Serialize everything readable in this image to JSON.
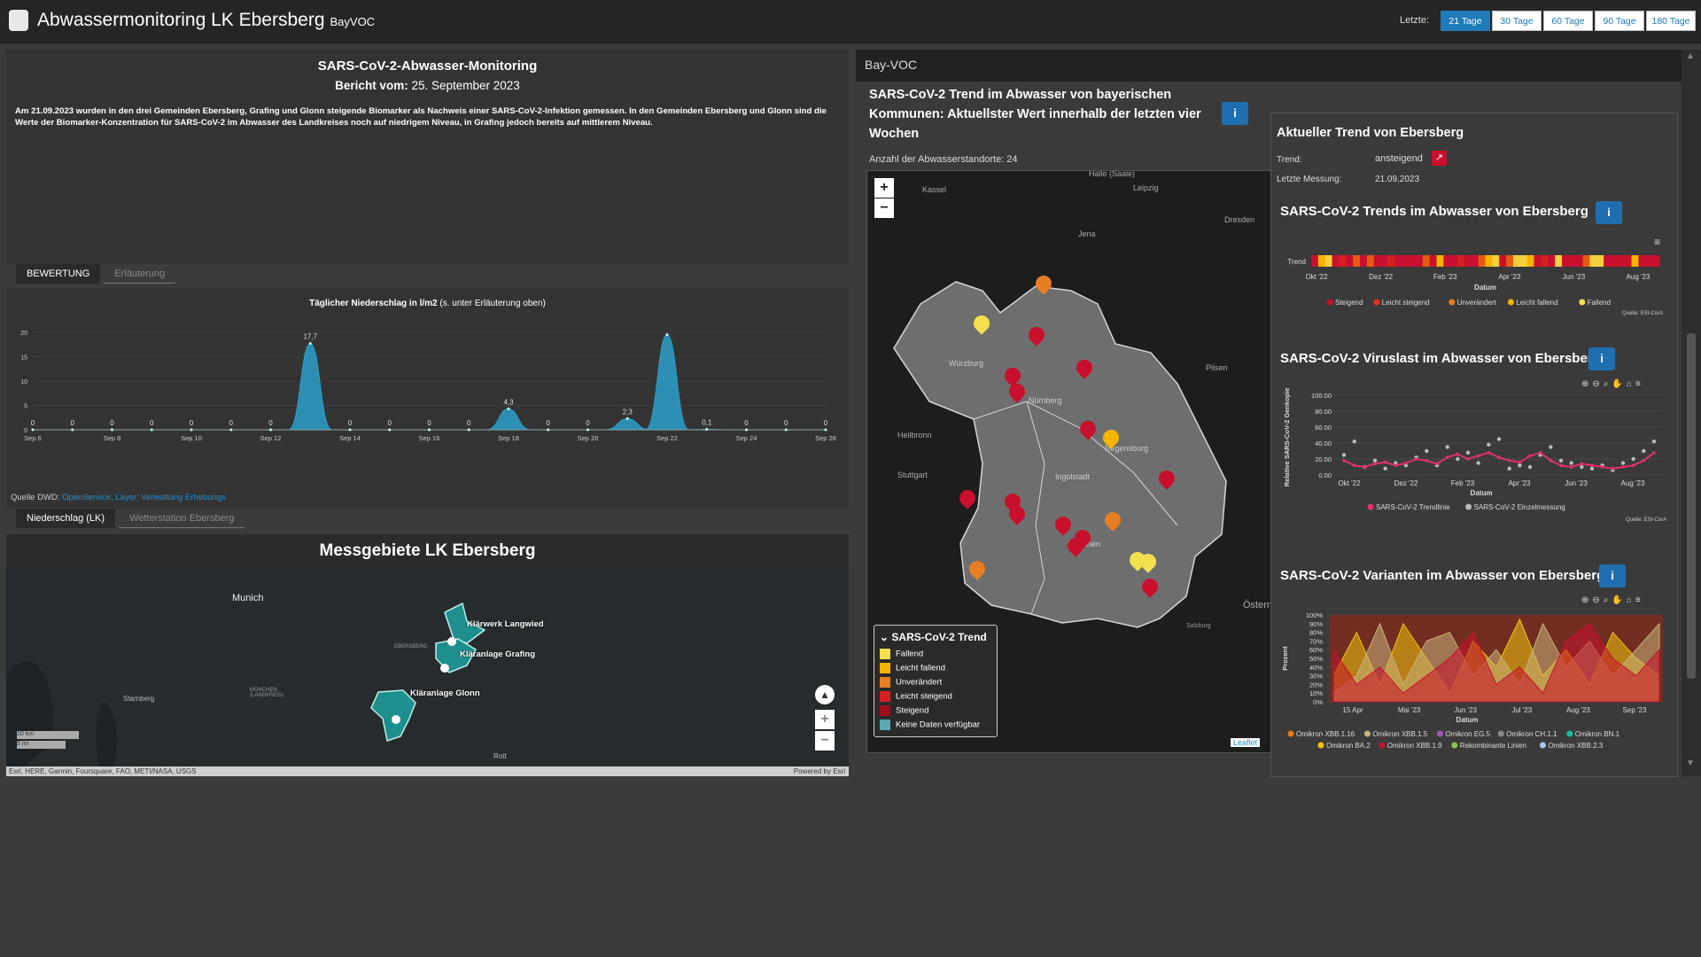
{
  "header": {
    "title": "Abwassermonitoring LK Ebersberg",
    "subtitle": "BayVOC",
    "range_label": "Letzte:",
    "ranges": [
      "21 Tage",
      "30 Tage",
      "60 Tage",
      "90 Tage",
      "180 Tage"
    ],
    "active_range": "21 Tage"
  },
  "report": {
    "title": "SARS-CoV-2-Abwasser-Monitoring",
    "date_label": "Bericht vom:",
    "date_value": "25. September 2023",
    "text": "Am 21.09.2023 wurden in den drei Gemeinden Ebersberg, Grafing und Glonn steigende Biomarker als Nachweis einer SARS-CoV-2-Infektion gemessen. In den Gemeinden Ebersberg und Glonn sind die Werte der Biomarker-Konzentration für SARS-CoV-2 im Abwasser des Landkreises noch auf niedrigem Niveau, in Grafing jedoch bereits auf mittlerem Niveau."
  },
  "tabs_top": [
    "BEWERTUNG",
    "Erläuterung"
  ],
  "tabs_bottom": [
    "Niederschlag (LK)",
    "Wetterstation Ebersberg"
  ],
  "chart_title": "Täglicher Niederschlag in l/m2",
  "chart_title_note": "(s. unter Erläuterung oben)",
  "dwd": {
    "label": "Quelle DWD:",
    "link": "OpenService, Layer: Verwaltung Erhebungs"
  },
  "chart_data": [
    {
      "type": "area",
      "title": "Täglicher Niederschlag in l/m2",
      "x": [
        "Sep 6",
        "Sep 7",
        "Sep 8",
        "Sep 9",
        "Sep 10",
        "Sep 11",
        "Sep 12",
        "Sep 13",
        "Sep 14",
        "Sep 15",
        "Sep 16",
        "Sep 17",
        "Sep 18",
        "Sep 19",
        "Sep 20",
        "Sep 21",
        "Sep 22",
        "Sep 23",
        "Sep 24",
        "Sep 25",
        "Sep 26"
      ],
      "values": [
        0,
        0,
        0,
        0,
        0,
        0,
        0,
        17.7,
        0,
        0,
        0,
        0,
        4.3,
        0,
        0,
        2.3,
        19.5,
        0.1,
        0,
        0,
        0
      ],
      "data_labels": [
        "0",
        "0",
        "0",
        "0",
        "0",
        "0",
        "0",
        "17,7",
        "0",
        "0",
        "0",
        "0",
        "4,3",
        "0",
        "0",
        "2,3",
        "",
        "0,1",
        "0",
        "0",
        "0"
      ],
      "x_ticks": [
        "Sep 6",
        "Sep 8",
        "Sep 10",
        "Sep 12",
        "Sep 14",
        "Sep 16",
        "Sep 18",
        "Sep 20",
        "Sep 22",
        "Sep 24",
        "Sep 26"
      ],
      "y_ticks": [
        "0",
        "5",
        "10",
        "15",
        "20"
      ],
      "ylim": [
        0,
        20
      ],
      "color": "#2a9fc9"
    },
    {
      "type": "heatmap",
      "title": "SARS-CoV-2 Trends im Abwasser von Ebersberg",
      "ylabel": "Trend",
      "xlabel": "Datum",
      "x_ticks": [
        "Okt '22",
        "Dez '22",
        "Feb '23",
        "Apr '23",
        "Jun '23",
        "Aug '23"
      ],
      "cells": [
        "#c8102e",
        "#f4b400",
        "#f4d03f",
        "#c8102e",
        "#d62020",
        "#c8102e",
        "#e35b12",
        "#c8102e",
        "#e35b12",
        "#c8102e",
        "#c8102e",
        "#d62020",
        "#c8102e",
        "#c8102e",
        "#c8102e",
        "#c8102e",
        "#e35b12",
        "#c8102e",
        "#f4b400",
        "#c8102e",
        "#c8102e",
        "#d62020",
        "#c8102e",
        "#c8102e",
        "#e35b12",
        "#f4b400",
        "#f4d03f",
        "#c8102e",
        "#e35b12",
        "#f4d03f",
        "#f4d03f",
        "#f4b400",
        "#c8102e",
        "#d62020",
        "#c8102e",
        "#f4d03f",
        "#c8102e",
        "#c8102e",
        "#c8102e",
        "#e35b12",
        "#f4d03f",
        "#f4d03f",
        "#c8102e",
        "#c8102e",
        "#c8102e",
        "#c8102e",
        "#f4b400",
        "#c8102e",
        "#c8102e",
        "#c8102e"
      ],
      "legend": [
        {
          "label": "Steigend",
          "color": "#c8102e"
        },
        {
          "label": "Leicht steigend",
          "color": "#e0301e"
        },
        {
          "label": "Unverändert",
          "color": "#e67e22"
        },
        {
          "label": "Leicht fallend",
          "color": "#f4b400"
        },
        {
          "label": "Fallend",
          "color": "#f4e04f"
        }
      ],
      "source": "Quelle: ESI-CorA"
    },
    {
      "type": "line",
      "title": "SARS-CoV-2 Viruslast im Abwasser von Ebersberg",
      "ylabel": "Relative SARS-CoV-2 Genkopien",
      "xlabel": "Datum",
      "x_ticks": [
        "Okt '22",
        "Dez '22",
        "Feb '23",
        "Apr '23",
        "Jun '23",
        "Aug '23"
      ],
      "y_ticks": [
        "0.00",
        "20.00",
        "40.00",
        "60.00",
        "80.00",
        "100.00"
      ],
      "ylim": [
        0,
        100
      ],
      "series": [
        {
          "name": "SARS-CoV-2 Trendlinie",
          "color": "#e0306e",
          "values": [
            18,
            12,
            10,
            14,
            16,
            12,
            15,
            20,
            18,
            14,
            22,
            26,
            20,
            24,
            28,
            22,
            18,
            16,
            24,
            28,
            18,
            12,
            10,
            14,
            12,
            10,
            8,
            10,
            12,
            18,
            28
          ]
        },
        {
          "name": "SARS-CoV-2 Einzelmessung",
          "color": "#bbbbbb",
          "values": [
            25,
            42,
            10,
            18,
            8,
            15,
            12,
            22,
            30,
            12,
            35,
            20,
            28,
            15,
            38,
            45,
            8,
            12,
            10,
            25,
            35,
            18,
            15,
            10,
            8,
            12,
            6,
            15,
            20,
            30,
            42
          ]
        }
      ],
      "source": "Quelle: ESI-CorA"
    },
    {
      "type": "area",
      "title": "SARS-CoV-2 Varianten im Abwasser von Ebersberg",
      "ylabel": "Prozent",
      "xlabel": "Datum",
      "x_ticks": [
        "15 Apr",
        "Mai '23",
        "Jun '23",
        "Jul '23",
        "Aug '23",
        "Sep '23"
      ],
      "y_ticks": [
        "0%",
        "10%",
        "20%",
        "30%",
        "40%",
        "50%",
        "60%",
        "70%",
        "80%",
        "90%",
        "100%"
      ],
      "series": [
        {
          "name": "Omikron XBB.1.16",
          "color": "#e67e22"
        },
        {
          "name": "Omikron XBB.1.5",
          "color": "#c9b27c"
        },
        {
          "name": "Omikron EG.5",
          "color": "#9b59b6"
        },
        {
          "name": "Omikron CH.1.1",
          "color": "#888888"
        },
        {
          "name": "Omikron BN.1",
          "color": "#1abc9c"
        },
        {
          "name": "Omikron BA.2",
          "color": "#f1c40f"
        },
        {
          "name": "Omikron XBB.1.9",
          "color": "#c8102e"
        },
        {
          "name": "Rekombinante Linien",
          "color": "#8bc34a"
        },
        {
          "name": "Omikron XBB.2.3",
          "color": "#a5c8ff"
        }
      ],
      "source": ""
    }
  ],
  "ebe_map": {
    "title": "Messgebiete LK Ebersberg",
    "places": [
      "Munich",
      "Starnberg",
      "Rott"
    ],
    "small_places": [
      "MÜNCHEN (LANDKREIS)",
      "EBERSBERG"
    ],
    "plants": [
      "Klärwerk Langwied",
      "Kläranlage Grafing",
      "Kläranlage Glonn"
    ],
    "scale": [
      "10 km",
      "5 mi"
    ],
    "attribution": "Esri, HERE, Garmin, Foursquare, FAO, METI/NASA, USGS",
    "powered": "Powered by Esri"
  },
  "bayvoc": {
    "header": "Bay-VOC",
    "title": "SARS-CoV-2 Trend im Abwasser von bayerischen Kommunen: Aktuellster Wert innerhalb der letzten vier Wochen",
    "count_label": "Anzahl der Abwasserstandorte: 24",
    "cities": [
      "Halle (Saale)",
      "Leipzig",
      "Kassel",
      "Dresden",
      "Jena",
      "Würzburg",
      "Nürnberg",
      "Regensburg",
      "Ingolstadt",
      "München",
      "Stuttgart",
      "Heilbronn",
      "Pilsen",
      "Salzburg",
      "Österr"
    ],
    "legend_title": "SARS-CoV-2 Trend",
    "legend": [
      {
        "label": "Fallend",
        "color": "#f4e04f"
      },
      {
        "label": "Leicht fallend",
        "color": "#f4b400"
      },
      {
        "label": "Unverändert",
        "color": "#e67e22"
      },
      {
        "label": "Leicht steigend",
        "color": "#d62020"
      },
      {
        "label": "Steigend",
        "color": "#a00d1e"
      },
      {
        "label": "Keine Daten verfügbar",
        "color": "#5aa9b5"
      }
    ],
    "leaflet": "Leaflet"
  },
  "current_trend": {
    "title": "Aktueller Trend von Ebersberg",
    "trend_label": "Trend:",
    "trend_value": "ansteigend",
    "last_label": "Letzte Messung:",
    "last_value": "21.09.2023"
  }
}
